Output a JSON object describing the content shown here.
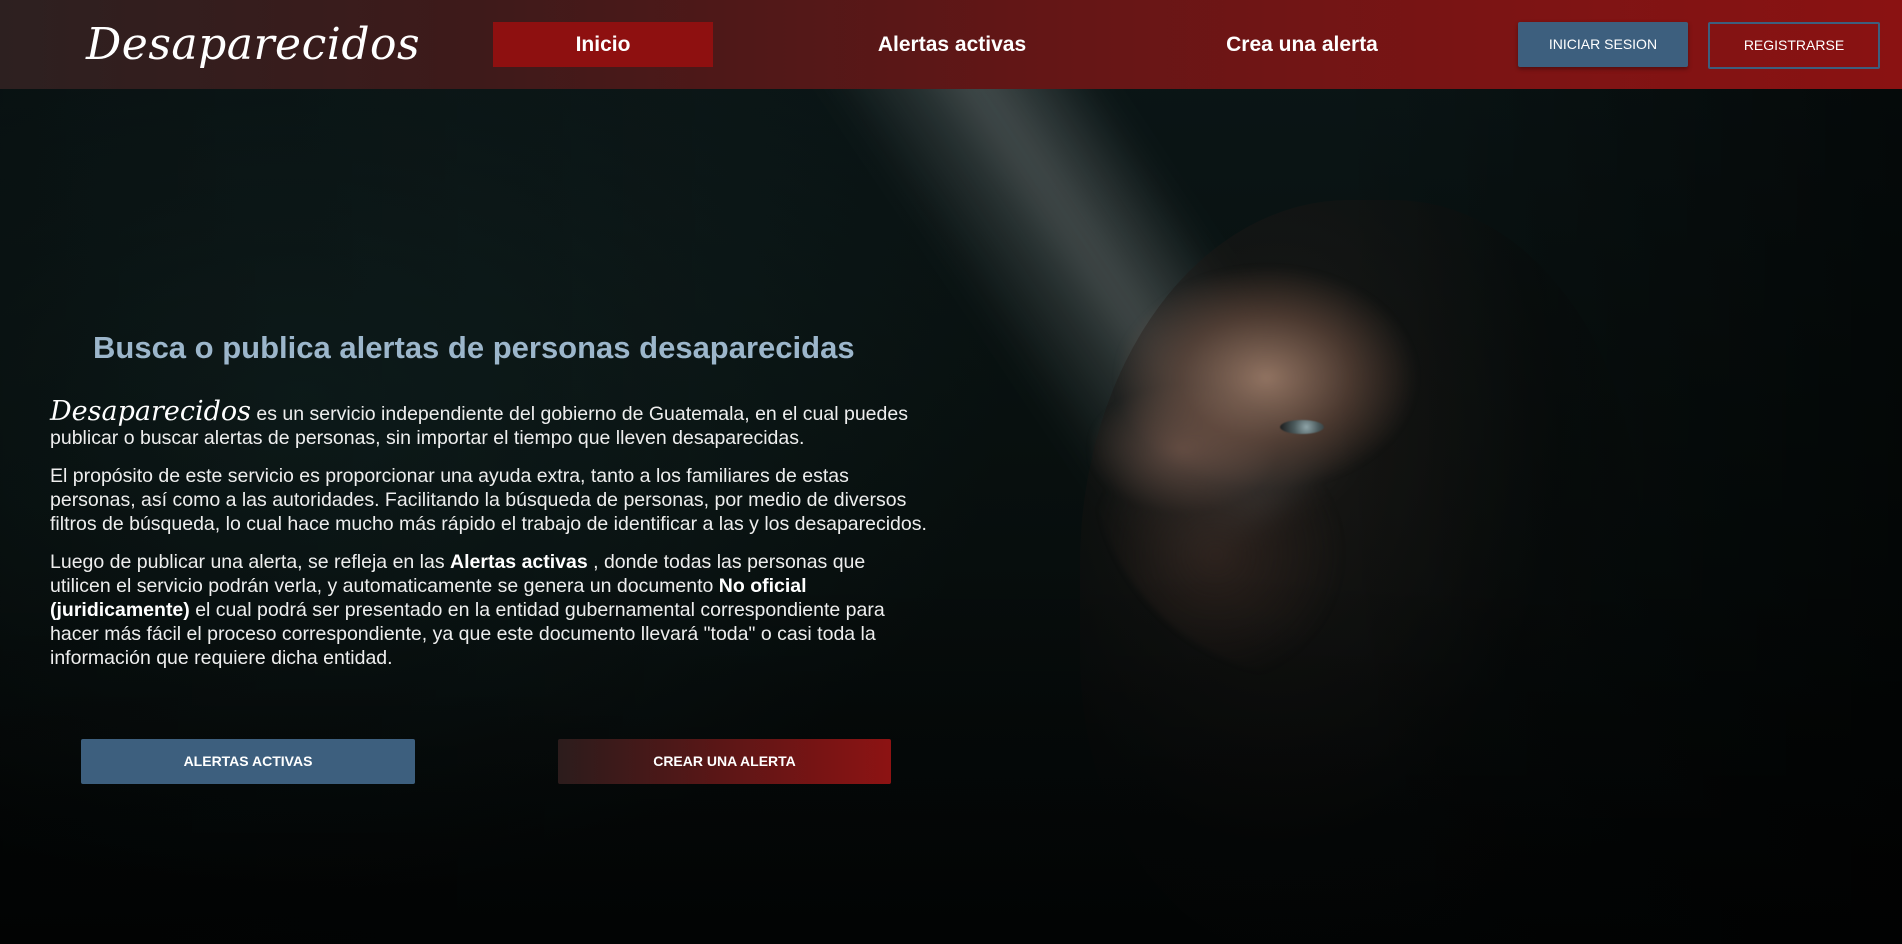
{
  "navbar": {
    "brand": "Desaparecidos",
    "links": [
      {
        "label": "Inicio"
      },
      {
        "label": "Alertas activas"
      },
      {
        "label": "Crea una alerta"
      }
    ],
    "login_label": "INICIAR SESION",
    "register_label": "REGISTRARSE"
  },
  "hero": {
    "title": "Busca o publica alertas de personas desaparecidas",
    "p1": {
      "brand": "Desaparecidos",
      "text": " es un servicio independiente del gobierno de Guatemala, en el cual puedes publicar o buscar alertas de personas, sin importar el tiempo que lleven desaparecidas."
    },
    "p2": "El propósito de este servicio es proporcionar una ayuda extra, tanto a los familiares de estas personas, así como a las autoridades. Facilitando la búsqueda de personas, por medio de diversos filtros de búsqueda, lo cual hace mucho más rápido el trabajo de identificar a las y los desaparecidos.",
    "p3": {
      "part1": "Luego de publicar una alerta, se refleja en las ",
      "bold1": "Alertas activas",
      "part2": " , donde todas las personas que utilicen el servicio podrán verla, y automaticamente se genera un documento ",
      "bold2": "No oficial (juridicamente)",
      "part3": " el cual podrá ser presentado en la entidad gubernamental correspondiente para hacer más fácil el proceso correspondiente, ya que este documento llevará \"toda\" o casi toda la información que requiere dicha entidad."
    },
    "cta_alerts": "ALERTAS ACTIVAS",
    "cta_create": "CREAR UNA ALERTA"
  },
  "colors": {
    "accent_red": "#8e1010",
    "accent_blue": "#3d5f7e",
    "title_blue": "#9cb6cb"
  }
}
